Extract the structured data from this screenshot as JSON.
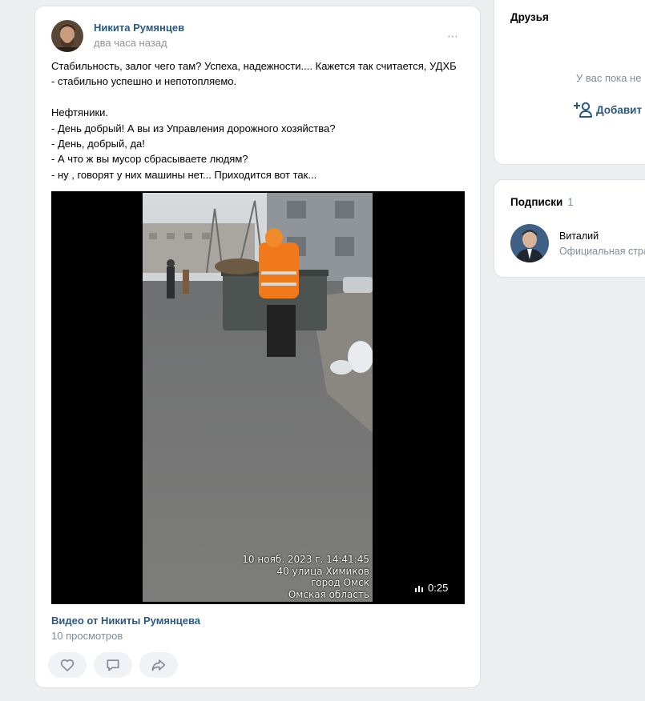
{
  "post": {
    "author": "Никита Румянцев",
    "time": "два часа назад",
    "more_icon": "⋯",
    "text_lines": [
      "Стабильность, залог чего там? Успеха, надежности.... Кажется так считается, УДХБ",
      "- стабильно успешно и непотопляемо.",
      "",
      "Нефтяники.",
      "- День добрый! А вы из Управления дорожного хозяйства?",
      "- День, добрый, да!",
      "- А что ж вы мусор сбрасываете людям?",
      "- ну , говорят у них машины нет... Приходится вот так..."
    ],
    "video": {
      "stamp_lines": [
        "10 нояб. 2023 г. 14:41:45",
        "40 улица Химиков",
        "город Омск",
        "Омская область"
      ],
      "duration": "0:25",
      "title": "Видео от Никиты Румянцева",
      "views": "10 просмотров"
    }
  },
  "friends": {
    "title": "Друзья",
    "empty_text": "У вас пока не",
    "add_label": "Добавит"
  },
  "subscriptions": {
    "title": "Подписки",
    "count": "1",
    "items": [
      {
        "name": "Виталий",
        "description": "Официальная стра"
      }
    ]
  },
  "colors": {
    "link": "#2a5885",
    "secondary": "#818c99",
    "background": "#edeef0"
  }
}
